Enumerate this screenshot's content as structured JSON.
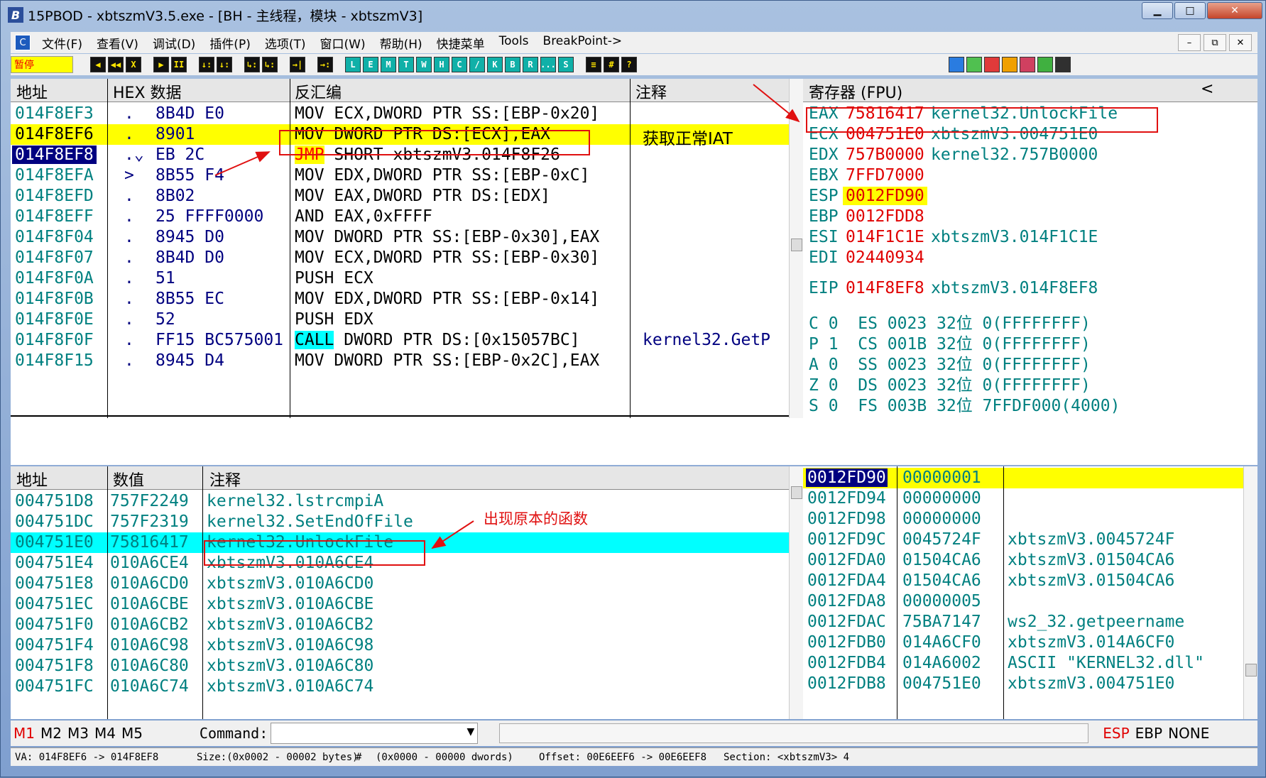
{
  "window": {
    "title": "15PBOD - xbtszmV3.5.exe - [BH - 主线程，模块 - xbtszmV3]",
    "app_icon": "B"
  },
  "menu": [
    "文件(F)",
    "查看(V)",
    "调试(D)",
    "插件(P)",
    "选项(T)",
    "窗口(W)",
    "帮助(H)",
    "快捷菜单",
    "Tools",
    "BreakPoint->"
  ],
  "toolbar": {
    "pause_label": "暂停",
    "buttons_a": [
      "◀",
      "◀◀",
      "X"
    ],
    "buttons_b": [
      "▶",
      "II"
    ],
    "buttons_c": [
      "↓:",
      "↓:"
    ],
    "buttons_d": [
      "↳:",
      "↳:"
    ],
    "buttons_e": [
      "→|"
    ],
    "buttons_f": [
      "→:"
    ],
    "letters": [
      "L",
      "E",
      "M",
      "T",
      "W",
      "H",
      "C",
      "/",
      "K",
      "B",
      "R",
      "...",
      "S"
    ],
    "grid": [
      "≡",
      "#",
      "?"
    ]
  },
  "disasm": {
    "headers": [
      "地址",
      "HEX 数据",
      "反汇编",
      "注释"
    ],
    "rows": [
      {
        "addr": "014F8EF3",
        "mark": ".",
        "hex": "8B4D E0",
        "op": "",
        "ins": "MOV ECX,DWORD PTR SS:[EBP-0x20]",
        "cmt": ""
      },
      {
        "addr": "014F8EF6",
        "mark": ".",
        "hex": "8901",
        "op": "",
        "ins": "MOV DWORD PTR DS:[ECX],EAX",
        "cmt": "获取正常IAT"
      },
      {
        "addr": "014F8EF8",
        "mark": ".⌄",
        "hex": "EB 2C",
        "op": "JMP",
        "ins": " SHORT xbtszmV3.014F8F26",
        "cmt": ""
      },
      {
        "addr": "014F8EFA",
        "mark": ">",
        "hex": "8B55 F4",
        "op": "",
        "ins": "MOV EDX,DWORD PTR SS:[EBP-0xC]",
        "cmt": ""
      },
      {
        "addr": "014F8EFD",
        "mark": ".",
        "hex": "8B02",
        "op": "",
        "ins": "MOV EAX,DWORD PTR DS:[EDX]",
        "cmt": ""
      },
      {
        "addr": "014F8EFF",
        "mark": ".",
        "hex": "25 FFFF0000",
        "op": "",
        "ins": "AND EAX,0xFFFF",
        "cmt": ""
      },
      {
        "addr": "014F8F04",
        "mark": ".",
        "hex": "8945 D0",
        "op": "",
        "ins": "MOV DWORD PTR SS:[EBP-0x30],EAX",
        "cmt": ""
      },
      {
        "addr": "014F8F07",
        "mark": ".",
        "hex": "8B4D D0",
        "op": "",
        "ins": "MOV ECX,DWORD PTR SS:[EBP-0x30]",
        "cmt": ""
      },
      {
        "addr": "014F8F0A",
        "mark": ".",
        "hex": "51",
        "op": "",
        "ins": "PUSH ECX",
        "cmt": ""
      },
      {
        "addr": "014F8F0B",
        "mark": ".",
        "hex": "8B55 EC",
        "op": "",
        "ins": "MOV EDX,DWORD PTR SS:[EBP-0x14]",
        "cmt": ""
      },
      {
        "addr": "014F8F0E",
        "mark": ".",
        "hex": "52",
        "op": "",
        "ins": "PUSH EDX",
        "cmt": ""
      },
      {
        "addr": "014F8F0F",
        "mark": ".",
        "hex": "FF15 BC575001",
        "op": "CALL",
        "ins": " DWORD PTR DS:[0x15057BC]",
        "cmt": "kernel32.GetP"
      },
      {
        "addr": "014F8F15",
        "mark": ".",
        "hex": "8945 D4",
        "op": "",
        "ins": "MOV DWORD PTR SS:[EBP-0x2C],EAX",
        "cmt": ""
      }
    ]
  },
  "registers": {
    "header": "寄存器 (FPU)",
    "collapse": "<",
    "gp": [
      {
        "name": "EAX",
        "val": "75816417",
        "info": "kernel32.UnlockFile"
      },
      {
        "name": "ECX",
        "val": "004751E0",
        "info": "xbtszmV3.004751E0"
      },
      {
        "name": "EDX",
        "val": "757B0000",
        "info": "kernel32.757B0000"
      },
      {
        "name": "EBX",
        "val": "7FFD7000",
        "info": ""
      },
      {
        "name": "ESP",
        "val": "0012FD90",
        "info": ""
      },
      {
        "name": "EBP",
        "val": "0012FDD8",
        "info": ""
      },
      {
        "name": "ESI",
        "val": "014F1C1E",
        "info": "xbtszmV3.014F1C1E"
      },
      {
        "name": "EDI",
        "val": "02440934",
        "info": ""
      }
    ],
    "eip": {
      "name": "EIP",
      "val": "014F8EF8",
      "info": "xbtszmV3.014F8EF8"
    },
    "flags": [
      "C 0  ES 0023 32位 0(FFFFFFFF)",
      "P 1  CS 001B 32位 0(FFFFFFFF)",
      "A 0  SS 0023 32位 0(FFFFFFFF)",
      "Z 0  DS 0023 32位 0(FFFFFFFF)",
      "S 0  FS 003B 32位 7FFDF000(4000)"
    ]
  },
  "dump": {
    "headers": [
      "地址",
      "数值",
      "注释"
    ],
    "rows": [
      {
        "addr": "004751D8",
        "val": "757F2249",
        "cmt": "kernel32.lstrcmpiA"
      },
      {
        "addr": "004751DC",
        "val": "757F2319",
        "cmt": "kernel32.SetEndOfFile"
      },
      {
        "addr": "004751E0",
        "val": "75816417",
        "cmt": "kernel32.UnlockFile"
      },
      {
        "addr": "004751E4",
        "val": "010A6CE4",
        "cmt": "xbtszmV3.010A6CE4"
      },
      {
        "addr": "004751E8",
        "val": "010A6CD0",
        "cmt": "xbtszmV3.010A6CD0"
      },
      {
        "addr": "004751EC",
        "val": "010A6CBE",
        "cmt": "xbtszmV3.010A6CBE"
      },
      {
        "addr": "004751F0",
        "val": "010A6CB2",
        "cmt": "xbtszmV3.010A6CB2"
      },
      {
        "addr": "004751F4",
        "val": "010A6C98",
        "cmt": "xbtszmV3.010A6C98"
      },
      {
        "addr": "004751F8",
        "val": "010A6C80",
        "cmt": "xbtszmV3.010A6C80"
      },
      {
        "addr": "004751FC",
        "val": "010A6C74",
        "cmt": "xbtszmV3.010A6C74"
      }
    ]
  },
  "stack": {
    "rows": [
      {
        "addr": "0012FD90",
        "val": "00000001",
        "cmt": ""
      },
      {
        "addr": "0012FD94",
        "val": "00000000",
        "cmt": ""
      },
      {
        "addr": "0012FD98",
        "val": "00000000",
        "cmt": ""
      },
      {
        "addr": "0012FD9C",
        "val": "0045724F",
        "cmt": "xbtszmV3.0045724F"
      },
      {
        "addr": "0012FDA0",
        "val": "01504CA6",
        "cmt": "xbtszmV3.01504CA6"
      },
      {
        "addr": "0012FDA4",
        "val": "01504CA6",
        "cmt": "xbtszmV3.01504CA6"
      },
      {
        "addr": "0012FDA8",
        "val": "00000005",
        "cmt": ""
      },
      {
        "addr": "0012FDAC",
        "val": "75BA7147",
        "cmt": "ws2_32.getpeername"
      },
      {
        "addr": "0012FDB0",
        "val": "014A6CF0",
        "cmt": "xbtszmV3.014A6CF0"
      },
      {
        "addr": "0012FDB4",
        "val": "014A6002",
        "cmt": "ASCII \"KERNEL32.dll\""
      },
      {
        "addr": "0012FDB8",
        "val": "004751E0",
        "cmt": "xbtszmV3.004751E0"
      }
    ]
  },
  "annotations": {
    "dump_note": "出现原本的函数"
  },
  "command": {
    "marks": [
      "M1",
      "M2",
      "M3",
      "M4",
      "M5"
    ],
    "label": "Command:",
    "value": "",
    "stack_marks": [
      "ESP",
      "EBP",
      "NONE"
    ]
  },
  "statusbar": {
    "va": "VA: 014F8EF6 -> 014F8EF8",
    "size": "Size:(0x0002 - 00002 bytes)",
    "hash": "#",
    "dwords": "(0x0000 - 00000 dwords)",
    "offset": "Offset: 00E6EEF6 -> 00E6EEF8",
    "section": "Section: <xbtszmV3> 4"
  },
  "colors": {
    "accent_red": "#e00000",
    "teal": "#008080",
    "highlight_yellow": "#ffff00",
    "cyan": "#00ffff",
    "selection_navy": "#000080"
  }
}
